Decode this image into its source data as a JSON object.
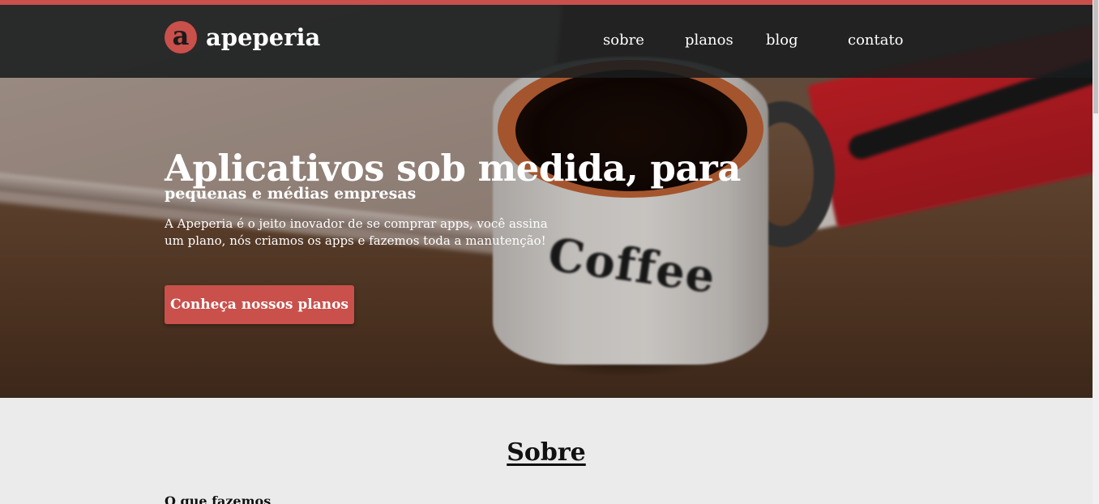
{
  "nav": {
    "logo_mark": "a",
    "logo_text": "apeperia",
    "items": [
      {
        "label": "sobre"
      },
      {
        "label": "planos"
      },
      {
        "label": "blog"
      },
      {
        "label": "contato"
      }
    ]
  },
  "hero": {
    "title": "Aplicativos sob medida, para",
    "subtitle": "pequenas e médias empresas",
    "description": "A Apeperia é o jeito inovador de se comprar apps, você assina um plano, nós criamos os apps e fazemos toda a manutenção!",
    "cta_label": "Conheça nossos planos",
    "mug_text": "Coffee"
  },
  "about": {
    "title": "Sobre",
    "subtitle": "O que fazemos"
  },
  "colors": {
    "accent": "#c9504b",
    "nav_bg": "#1a1d1f",
    "page_bg": "#ebebeb"
  }
}
